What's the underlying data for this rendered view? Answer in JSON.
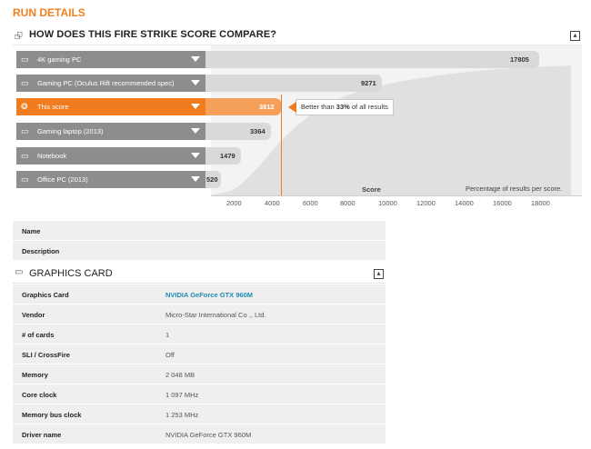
{
  "page": {
    "title": "RUN DETAILS"
  },
  "compare": {
    "heading": "HOW DOES THIS FIRE STRIKE SCORE COMPARE?",
    "tooltip": {
      "prefix": "Better than ",
      "percent": "33%",
      "suffix": " of all results"
    },
    "score_axis_label": "Score",
    "percentage_label": "Percentage of results per score.",
    "x_ticks": [
      "2000",
      "4000",
      "6000",
      "8000",
      "10000",
      "12000",
      "14000",
      "16000",
      "18000"
    ],
    "rows": [
      {
        "label": "4K gaming PC",
        "value": "17805",
        "icon": "monitor-icon"
      },
      {
        "label": "Gaming PC (Oculus Rift recommended spec)",
        "value": "9271",
        "icon": "monitor-icon"
      },
      {
        "label": "This score",
        "value": "3812",
        "icon": "lightbulb-icon",
        "highlight": true
      },
      {
        "label": "Gaming laptop (2013)",
        "value": "3364",
        "icon": "laptop-icon"
      },
      {
        "label": "Notebook",
        "value": "1479",
        "icon": "laptop-icon"
      },
      {
        "label": "Office PC (2013)",
        "value": "520",
        "icon": "monitor-icon"
      }
    ]
  },
  "details": [
    {
      "key": "Name",
      "value": ""
    },
    {
      "key": "Description",
      "value": ""
    }
  ],
  "graphics_card": {
    "heading": "GRAPHICS CARD",
    "rows": [
      {
        "key": "Graphics Card",
        "value": "NVIDIA GeForce GTX 960M",
        "link": true
      },
      {
        "key": "Vendor",
        "value": "Micro-Star International Co ., Ltd."
      },
      {
        "key": "# of cards",
        "value": "1"
      },
      {
        "key": "SLI / CrossFire",
        "value": "Off"
      },
      {
        "key": "Memory",
        "value": "2 048 MB"
      },
      {
        "key": "Core clock",
        "value": "1 097 MHz"
      },
      {
        "key": "Memory bus clock",
        "value": "1 253 MHz"
      },
      {
        "key": "Driver name",
        "value": "NVIDIA GeForce GTX 960M"
      }
    ]
  },
  "colors": {
    "accent": "#f07c1f",
    "link": "#1f8bb5",
    "bar": "#d9d9d9",
    "label_box": "#8d8d8d"
  }
}
